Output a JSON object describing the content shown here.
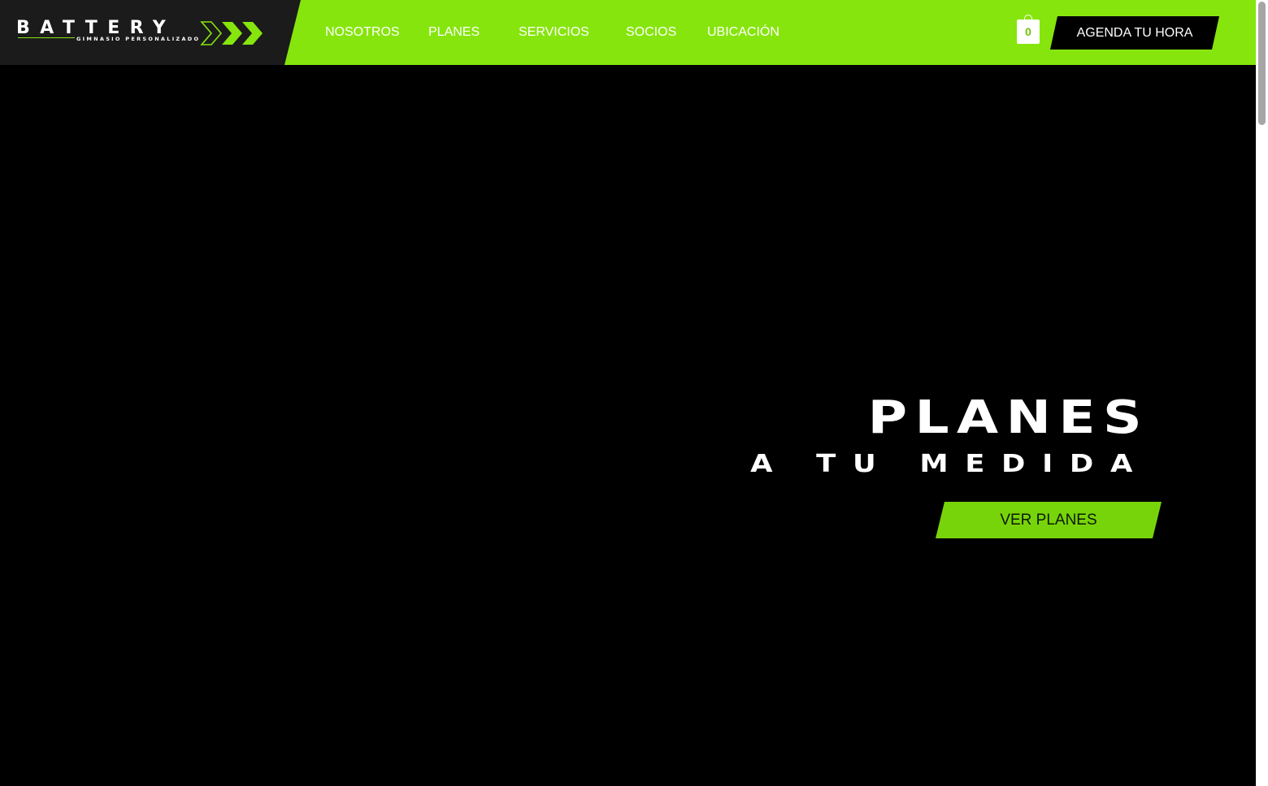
{
  "brand": {
    "name": "BATTERY",
    "tagline": "GIMNASIO PERSONALIZADO",
    "logo_icon": "triple-chevron-arrows-icon"
  },
  "nav": {
    "items": [
      {
        "label": "NOSOTROS"
      },
      {
        "label": "PLANES"
      },
      {
        "label": "SERVICIOS"
      },
      {
        "label": "SOCIOS"
      },
      {
        "label": "UBICACIÓN"
      }
    ]
  },
  "cart": {
    "icon": "shopping-bag-icon",
    "count": "0"
  },
  "header_cta": {
    "label": "AGENDA TU HORA"
  },
  "hero": {
    "title": "PLANES",
    "subtitle": "A TU MEDIDA",
    "button_label": "VER PLANES"
  },
  "colors": {
    "accent_green": "#86e50d",
    "button_green": "#78d40a",
    "background": "#000000",
    "logo_panel": "#1b1b1b",
    "text_light": "#ffffff"
  }
}
